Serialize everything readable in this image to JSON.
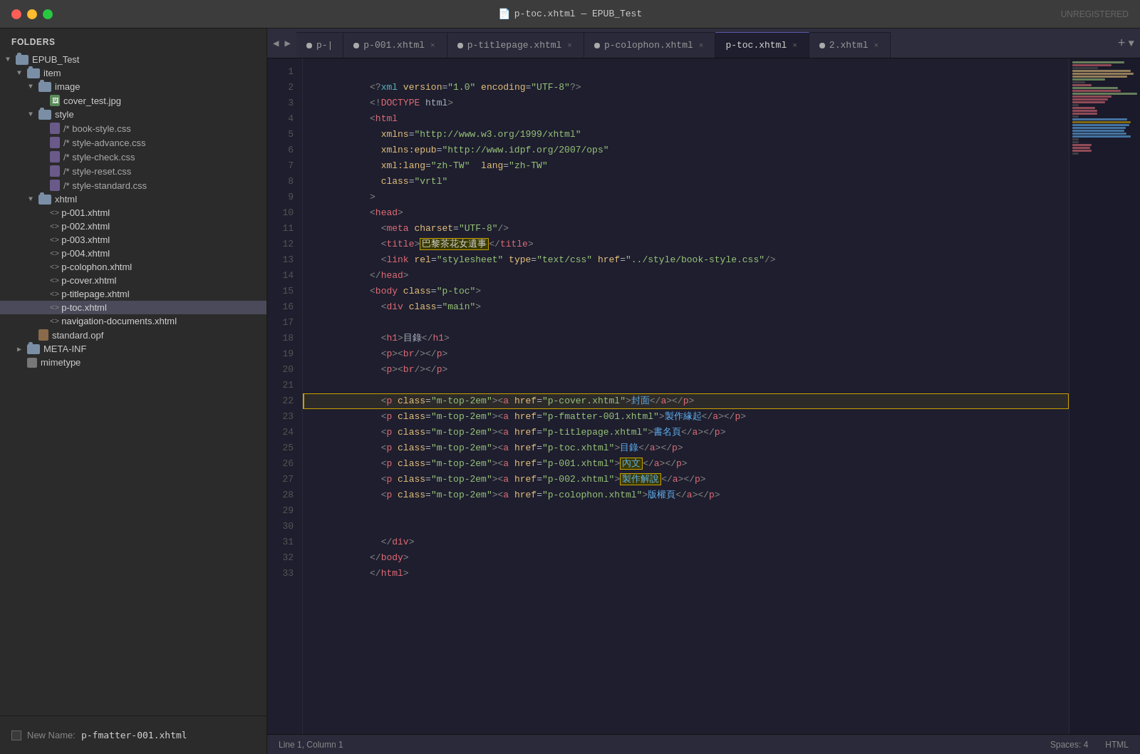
{
  "title_bar": {
    "title": "p-toc.xhtml — EPUB_Test",
    "unregistered": "UNREGISTERED"
  },
  "sidebar": {
    "header": "FOLDERS",
    "tree": [
      {
        "id": "epub-test",
        "label": "EPUB_Test",
        "type": "folder",
        "indent": 0,
        "expanded": true,
        "arrow": "▼"
      },
      {
        "id": "item",
        "label": "item",
        "type": "folder",
        "indent": 1,
        "expanded": true,
        "arrow": "▼"
      },
      {
        "id": "image",
        "label": "image",
        "type": "folder",
        "indent": 2,
        "expanded": true,
        "arrow": "▼"
      },
      {
        "id": "cover-test-jpg",
        "label": "cover_test.jpg",
        "type": "img",
        "indent": 3,
        "arrow": ""
      },
      {
        "id": "style",
        "label": "style",
        "type": "folder",
        "indent": 2,
        "expanded": true,
        "arrow": "▼"
      },
      {
        "id": "book-style-css",
        "label": "/* book-style.css",
        "type": "css",
        "indent": 3,
        "arrow": ""
      },
      {
        "id": "style-advance-css",
        "label": "/* style-advance.css",
        "type": "css",
        "indent": 3,
        "arrow": ""
      },
      {
        "id": "style-check-css",
        "label": "/* style-check.css",
        "type": "css",
        "indent": 3,
        "arrow": ""
      },
      {
        "id": "style-reset-css",
        "label": "/* style-reset.css",
        "type": "css",
        "indent": 3,
        "arrow": ""
      },
      {
        "id": "style-standard-css",
        "label": "/* style-standard.css",
        "type": "css",
        "indent": 3,
        "arrow": ""
      },
      {
        "id": "xhtml",
        "label": "xhtml",
        "type": "folder",
        "indent": 2,
        "expanded": true,
        "arrow": "▼"
      },
      {
        "id": "p-001-xhtml",
        "label": "p-001.xhtml",
        "type": "xml",
        "indent": 3,
        "arrow": ""
      },
      {
        "id": "p-002-xhtml",
        "label": "p-002.xhtml",
        "type": "xml",
        "indent": 3,
        "arrow": ""
      },
      {
        "id": "p-003-xhtml",
        "label": "p-003.xhtml",
        "type": "xml",
        "indent": 3,
        "arrow": ""
      },
      {
        "id": "p-004-xhtml",
        "label": "p-004.xhtml",
        "type": "xml",
        "indent": 3,
        "arrow": ""
      },
      {
        "id": "p-colophon-xhtml",
        "label": "p-colophon.xhtml",
        "type": "xml",
        "indent": 3,
        "arrow": ""
      },
      {
        "id": "p-cover-xhtml",
        "label": "p-cover.xhtml",
        "type": "xml",
        "indent": 3,
        "arrow": ""
      },
      {
        "id": "p-titlepage-xhtml",
        "label": "p-titlepage.xhtml",
        "type": "xml",
        "indent": 3,
        "arrow": ""
      },
      {
        "id": "p-toc-xhtml",
        "label": "p-toc.xhtml",
        "type": "xml",
        "indent": 3,
        "arrow": "",
        "selected": true
      },
      {
        "id": "navigation-documents-xhtml",
        "label": "navigation-documents.xhtml",
        "type": "xml",
        "indent": 3,
        "arrow": ""
      },
      {
        "id": "standard-opf",
        "label": "standard.opf",
        "type": "opf",
        "indent": 2,
        "arrow": ""
      },
      {
        "id": "meta-inf",
        "label": "META-INF",
        "type": "folder",
        "indent": 1,
        "expanded": false,
        "arrow": "▶"
      },
      {
        "id": "mimetype",
        "label": "mimetype",
        "type": "file",
        "indent": 1,
        "arrow": ""
      }
    ]
  },
  "bottom_bar": {
    "label": "New Name:",
    "value": "p-fmatter-001.xhtml"
  },
  "tabs": [
    {
      "id": "tab-back",
      "label": "◀",
      "nav": true
    },
    {
      "id": "tab-forward",
      "label": "▶",
      "nav": true
    },
    {
      "id": "p-dot",
      "label": "p-|",
      "type": "tab",
      "has_dot": true,
      "active": false
    },
    {
      "id": "p-001-xhtml-tab",
      "label": "p-001.xhtml",
      "type": "tab",
      "has_dot": true,
      "active": false
    },
    {
      "id": "p-titlepage-tab",
      "label": "p-titlepage.xhtml",
      "type": "tab",
      "has_dot": true,
      "active": false
    },
    {
      "id": "p-colophon-tab",
      "label": "p-colophon.xhtml",
      "type": "tab",
      "has_dot": true,
      "active": false
    },
    {
      "id": "p-toc-tab",
      "label": "p-toc.xhtml",
      "type": "tab",
      "has_dot": false,
      "active": true
    },
    {
      "id": "2-xhtml-tab",
      "label": "2.xhtml",
      "type": "tab",
      "has_dot": true,
      "active": false
    }
  ],
  "code": {
    "lines": [
      {
        "num": 1,
        "content": "<?xml version=\"1.0\" encoding=\"UTF-8\"?>",
        "type": "pi"
      },
      {
        "num": 2,
        "content": "<!DOCTYPE html>",
        "type": "doctype"
      },
      {
        "num": 3,
        "content": "<html",
        "type": "tag"
      },
      {
        "num": 4,
        "content": "  xmlns=\"http://www.w3.org/1999/xhtml\"",
        "type": "attr"
      },
      {
        "num": 5,
        "content": "  xmlns:epub=\"http://www.idpf.org/2007/ops\"",
        "type": "attr"
      },
      {
        "num": 6,
        "content": "  xml:lang=\"zh-TW\"  lang=\"zh-TW\"",
        "type": "attr"
      },
      {
        "num": 7,
        "content": "  class=\"vrtl\"",
        "type": "attr"
      },
      {
        "num": 8,
        "content": ">",
        "type": "punct"
      },
      {
        "num": 9,
        "content": "<head>",
        "type": "tag"
      },
      {
        "num": 10,
        "content": "  <meta charset=\"UTF-8\"/>",
        "type": "tag"
      },
      {
        "num": 11,
        "content": "  <title>巴黎茶花女遺事</title>",
        "type": "tag_with_highlight"
      },
      {
        "num": 12,
        "content": "  <link rel=\"stylesheet\" type=\"text/css\" href=\"../style/book-style.css\"/>",
        "type": "tag"
      },
      {
        "num": 13,
        "content": "</head>",
        "type": "tag"
      },
      {
        "num": 14,
        "content": "<body class=\"p-toc\">",
        "type": "tag"
      },
      {
        "num": 15,
        "content": "  <div class=\"main\">",
        "type": "tag"
      },
      {
        "num": 16,
        "content": "",
        "type": "empty"
      },
      {
        "num": 17,
        "content": "  <h1>目錄</h1>",
        "type": "tag"
      },
      {
        "num": 18,
        "content": "  <p><br/></p>",
        "type": "tag"
      },
      {
        "num": 19,
        "content": "  <p><br/></p>",
        "type": "tag"
      },
      {
        "num": 20,
        "content": "",
        "type": "empty"
      },
      {
        "num": 21,
        "content": "  <p class=\"m-top-2em\"><a href=\"p-cover.xhtml\">封面</a></p>",
        "type": "tag"
      },
      {
        "num": 22,
        "content": "  <p class=\"m-top-2em\"><a href=\"p-fmatter-001.xhtml\">製作緣起</a></p>",
        "type": "tag_highlighted"
      },
      {
        "num": 23,
        "content": "  <p class=\"m-top-2em\"><a href=\"p-titlepage.xhtml\">書名頁</a></p>",
        "type": "tag"
      },
      {
        "num": 24,
        "content": "  <p class=\"m-top-2em\"><a href=\"p-toc.xhtml\">目錄</a></p>",
        "type": "tag"
      },
      {
        "num": 25,
        "content": "  <p class=\"m-top-2em\"><a href=\"p-001.xhtml\">內文</a></p>",
        "type": "tag_with_box1"
      },
      {
        "num": 26,
        "content": "  <p class=\"m-top-2em\"><a href=\"p-002.xhtml\">製作解說</a></p>",
        "type": "tag_with_box2"
      },
      {
        "num": 27,
        "content": "  <p class=\"m-top-2em\"><a href=\"p-colophon.xhtml\">版權頁</a></p>",
        "type": "tag"
      },
      {
        "num": 28,
        "content": "",
        "type": "empty"
      },
      {
        "num": 29,
        "content": "",
        "type": "empty"
      },
      {
        "num": 30,
        "content": "  </div>",
        "type": "tag"
      },
      {
        "num": 31,
        "content": "</body>",
        "type": "tag"
      },
      {
        "num": 32,
        "content": "</html>",
        "type": "tag"
      },
      {
        "num": 33,
        "content": "",
        "type": "empty"
      }
    ]
  },
  "status_bar": {
    "position": "Line 1, Column 1",
    "spaces": "Spaces: 4",
    "language": "HTML"
  }
}
